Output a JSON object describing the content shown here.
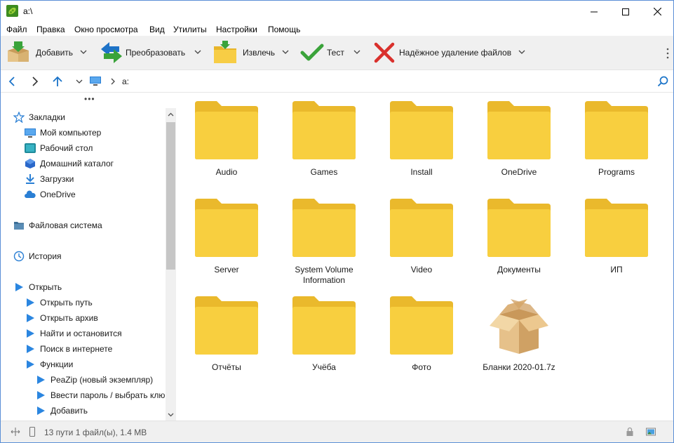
{
  "window": {
    "title": "a:\\",
    "accent": "#5b8fd6"
  },
  "menu": [
    "Файл",
    "Правка",
    "Окно просмотра",
    "Вид",
    "Утилиты",
    "Настройки",
    "Помощь"
  ],
  "toolbar": {
    "add_label": "Добавить",
    "convert_label": "Преобразовать",
    "extract_label": "Извлечь",
    "test_label": "Тест",
    "wipe_label": "Надёжное удаление файлов"
  },
  "address": {
    "path": "a:"
  },
  "sidebar": {
    "bookmarks_label": "Закладки",
    "bookmarks": [
      "Мой компьютер",
      "Рабочий стол",
      "Домашний каталог",
      "Загрузки",
      "OneDrive"
    ],
    "filesystem_label": "Файловая система",
    "history_label": "История",
    "open_label": "Открыть",
    "open_items": [
      "Открыть путь",
      "Открыть архив",
      "Найти и остановится",
      "Поиск в интернете",
      "Функции"
    ],
    "function_items": [
      "PeaZip (новый экземпляр)",
      "Ввести пароль / выбрать клю",
      "Добавить"
    ]
  },
  "files": [
    {
      "name": "Audio",
      "icon": "folder-icon"
    },
    {
      "name": "Games",
      "icon": "folder-icon"
    },
    {
      "name": "Install",
      "icon": "folder-icon"
    },
    {
      "name": "OneDrive",
      "icon": "folder-icon"
    },
    {
      "name": "Programs",
      "icon": "folder-icon"
    },
    {
      "name": "Server",
      "icon": "folder-icon"
    },
    {
      "name": "System Volume Information",
      "icon": "folder-icon"
    },
    {
      "name": "Video",
      "icon": "folder-icon"
    },
    {
      "name": "Документы",
      "icon": "folder-icon"
    },
    {
      "name": "ИП",
      "icon": "folder-icon"
    },
    {
      "name": "Отчёты",
      "icon": "folder-icon"
    },
    {
      "name": "Учёба",
      "icon": "folder-icon"
    },
    {
      "name": "Фото",
      "icon": "folder-icon"
    },
    {
      "name": "Бланки 2020-01.7z",
      "icon": "archive-box-icon"
    }
  ],
  "status": {
    "text": "13 пути 1 файл(ы), 1.4 MB"
  },
  "colors": {
    "folder": "#f8cf3f",
    "folder_back": "#eab92c",
    "nav_blue": "#1a73c8",
    "play_blue": "#2b86e0"
  }
}
